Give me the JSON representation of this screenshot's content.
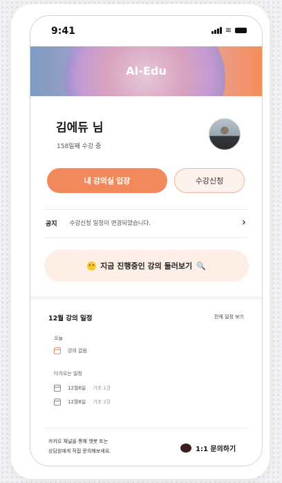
{
  "status_bar": {
    "time": "9:41"
  },
  "banner": {
    "title": "AI-Edu"
  },
  "user": {
    "name": "김에듀 님",
    "subtitle": "158일째 수강 중"
  },
  "buttons": {
    "primary": "내 강의실 입장",
    "secondary": "수강신청"
  },
  "notice": {
    "tag": "공지",
    "text": "수강신청 일정이 변경되었습니다."
  },
  "featured": {
    "label": "지금 진행중인 강의 둘러보기"
  },
  "schedule": {
    "title": "12월 강의 일정",
    "view_all": "전체 일정 보기",
    "today_label": "오늘",
    "today_item": "강의 없음",
    "upcoming_label": "다가오는 일정",
    "upcoming": [
      {
        "date": "12월6일",
        "title": "기초 1강"
      },
      {
        "date": "12월8일",
        "title": "기초 2강"
      }
    ]
  },
  "footer": {
    "line1": "카카오 채널을 통해 챗봇 또는",
    "line2": "상담원에게 직접 문의해보세요.",
    "contact_label": "1:1 문의하기"
  },
  "colors": {
    "accent": "#f2895d",
    "accent_light": "#fdeee6"
  },
  "icons": [
    "signal-icon",
    "wifi-icon",
    "battery-icon",
    "chevron-right-icon",
    "emoji-face-icon",
    "magnifier-icon",
    "calendar-icon",
    "kakao-chat-icon"
  ]
}
